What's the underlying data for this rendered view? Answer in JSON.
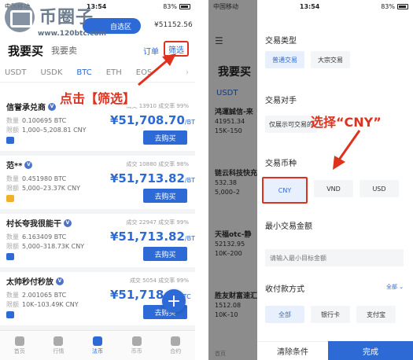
{
  "watermark": {
    "title": "币圈子",
    "url": "www.120btc.com"
  },
  "left": {
    "status": {
      "carrier": "中国移动",
      "time": "13:54",
      "battery": "83%"
    },
    "zone_button": "自选区",
    "balance": "¥51152.56",
    "tabs": {
      "buy": "我要买",
      "sell": "我要卖",
      "orders": "订单",
      "filter": "筛选"
    },
    "coins": [
      "USDT",
      "USDK",
      "BTC",
      "ETH",
      "EOS"
    ],
    "coin_active": "BTC",
    "annotation": "点击【筛选】",
    "listings": [
      {
        "name": "信誉承兑商",
        "stats": "成交 13910  成交率 99%",
        "qty": "0.100695 BTC",
        "limit": "1,000–5,208.81 CNY",
        "price": "¥51,708.70",
        "unit": "/BTC",
        "button": "去购买",
        "pay_color": "#2d6ad6"
      },
      {
        "name": "范**",
        "stats": "成交 10880  成交率 98%",
        "qty": "0.451980 BTC",
        "limit": "5,000–23.37K CNY",
        "price": "¥51,713.82",
        "unit": "/BTC",
        "button": "去购买",
        "pay_color": "#f2b02a"
      },
      {
        "name": "村长夸我很能干",
        "stats": "成交 22947  成交率 99%",
        "qty": "6.163409 BTC",
        "limit": "5,000–318.73K CNY",
        "price": "¥51,713.82",
        "unit": "/BTC",
        "button": "去购买",
        "pay_color": "#2d6ad6"
      },
      {
        "name": "太帅秒付秒放",
        "stats": "成交 5054  成交率 99%",
        "qty": "2.001065 BTC",
        "limit": "10K–103.49K CNY",
        "price": "¥51,718.9",
        "unit": "/BTC",
        "button": "去购买",
        "pay_color": "#2d6ad6"
      }
    ],
    "labels": {
      "qty": "数量",
      "limit": "限额"
    },
    "fab": "+",
    "nav": [
      {
        "label": "首页",
        "active": false
      },
      {
        "label": "行情",
        "active": false
      },
      {
        "label": "法币",
        "active": true
      },
      {
        "label": "币币",
        "active": false
      },
      {
        "label": "合约",
        "active": false
      }
    ]
  },
  "right": {
    "status": {
      "carrier": "中国移动",
      "time": "13:54",
      "battery": "83%"
    },
    "under": {
      "title": "我要买",
      "usdt": "USDT",
      "nav": "首页",
      "items": [
        {
          "name": "鸿運誠信-来",
          "qty": "41951.34",
          "lim": "15K–150"
        },
        {
          "name": "链云科技快充",
          "qty": "532.38",
          "lim": "5,000–2"
        },
        {
          "name": "天福otc-静",
          "qty": "52132.95",
          "lim": "10K–200"
        },
        {
          "name": "胜友财富速汇",
          "qty": "1512.08",
          "lim": "10K–10"
        }
      ]
    },
    "filter": {
      "trade_type_title": "交易类型",
      "trade_types": [
        "普通交易",
        "大宗交易"
      ],
      "counterparty_title": "交易对手",
      "counterparty_option": "仅展示可交易的",
      "currency_title": "交易币种",
      "currencies": [
        "CNY",
        "VND",
        "USD"
      ],
      "min_amount_title": "最小交易金额",
      "min_amount_placeholder": "请输入最小目标金额",
      "payment_title": "收付款方式",
      "payment_all": "全部",
      "payments": [
        "全部",
        "银行卡",
        "支付宝"
      ],
      "clear_button": "清除条件",
      "done_button": "完成"
    },
    "annotation": "选择“CNY”"
  },
  "colors": {
    "accent": "#2d6ad6",
    "annotation": "#e0301e"
  }
}
